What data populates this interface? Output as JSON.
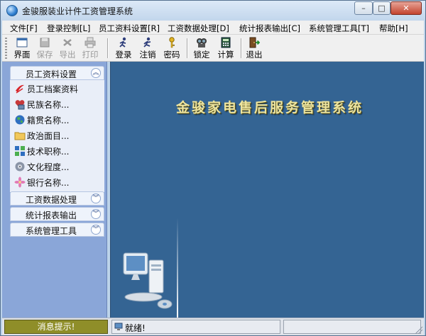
{
  "window": {
    "title": "金骏服装业计件工资管理系统",
    "controls": {
      "minimize": "–",
      "maximize": "□",
      "close": "✕"
    }
  },
  "menu": [
    "文件[F]",
    "登录控制[L]",
    "员工资料设置[R]",
    "工资数据处理[D]",
    "统计报表输出[C]",
    "系统管理工具[T]",
    "帮助[H]"
  ],
  "toolbar": {
    "buttons": [
      {
        "label": "界面",
        "icon": "window-icon",
        "enabled": true
      },
      {
        "label": "保存",
        "icon": "save-icon",
        "enabled": false
      },
      {
        "label": "导出",
        "icon": "export-icon",
        "enabled": false
      },
      {
        "label": "打印",
        "icon": "print-icon",
        "enabled": false
      },
      {
        "label": "登录",
        "icon": "login-icon",
        "enabled": true
      },
      {
        "label": "注销",
        "icon": "logout-icon",
        "enabled": true
      },
      {
        "label": "密码",
        "icon": "key-icon",
        "enabled": true
      },
      {
        "label": "锁定",
        "icon": "lock-icon",
        "enabled": true
      },
      {
        "label": "计算",
        "icon": "calculator-icon",
        "enabled": true
      },
      {
        "label": "退出",
        "icon": "exit-icon",
        "enabled": true
      }
    ]
  },
  "sidebar": {
    "groups": [
      {
        "title": "员工资料设置",
        "expanded": true,
        "items": [
          {
            "label": "员工档案资料",
            "icon": "employee-record-icon"
          },
          {
            "label": "民族名称...",
            "icon": "ethnicity-icon"
          },
          {
            "label": "籍贯名称...",
            "icon": "globe-icon"
          },
          {
            "label": "政治面目...",
            "icon": "folder-icon"
          },
          {
            "label": "技术职称...",
            "icon": "tech-title-icon"
          },
          {
            "label": "文化程度...",
            "icon": "education-icon"
          },
          {
            "label": "银行名称...",
            "icon": "bank-icon"
          }
        ]
      },
      {
        "title": "工资数据处理",
        "expanded": false
      },
      {
        "title": "统计报表输出",
        "expanded": false
      },
      {
        "title": "系统管理工具",
        "expanded": false
      }
    ]
  },
  "main": {
    "banner": "金骏家电售后服务管理系统"
  },
  "statusbar": {
    "message_hint": "消息提示!",
    "status": "就绪!"
  },
  "colors": {
    "main_background": "#346493",
    "banner_text": "#ede49f",
    "sidebar_background": "#8aa6d8",
    "message_hint_background": "#8f8e29"
  }
}
